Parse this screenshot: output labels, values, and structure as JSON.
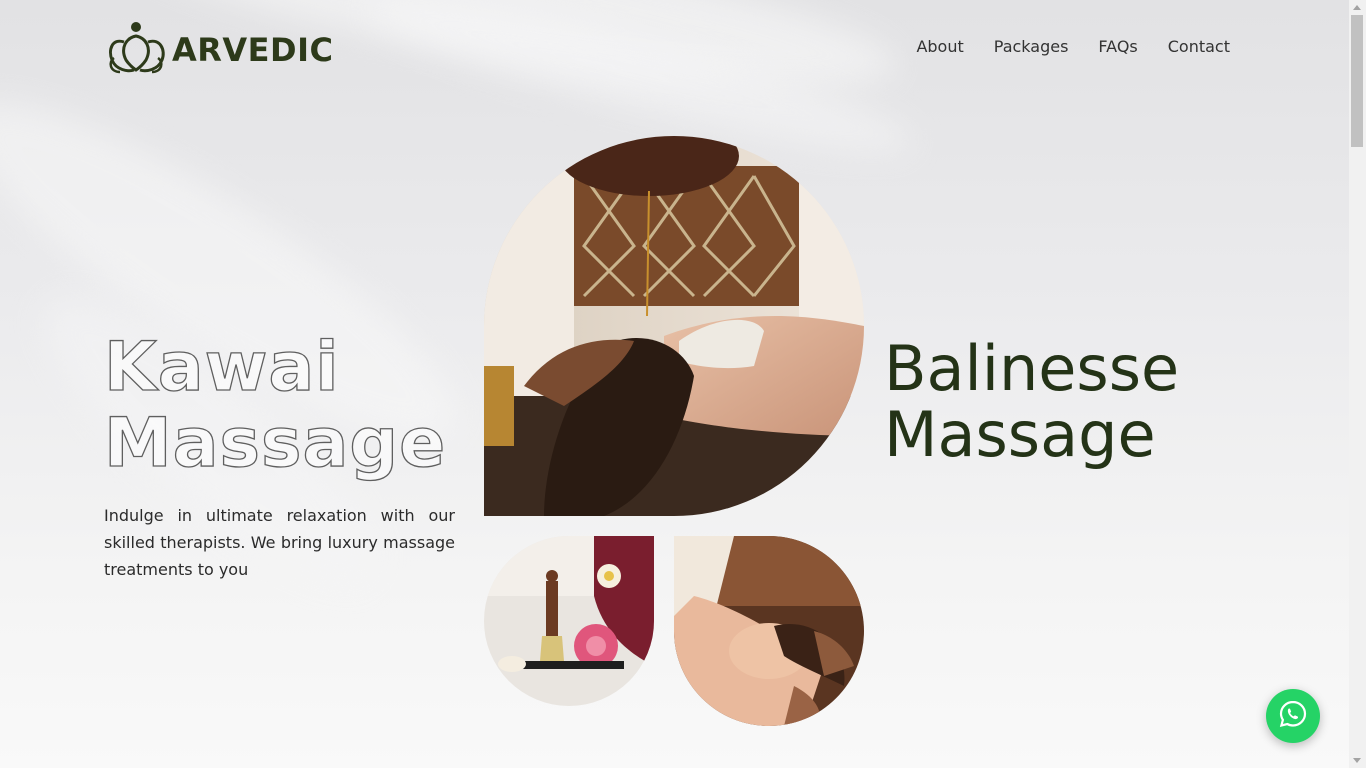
{
  "brand": {
    "name": "ARVEDIC",
    "logo_icon": "lotus-person-icon",
    "color": "#2d3a1a"
  },
  "nav": {
    "items": [
      "About",
      "Packages",
      "FAQs",
      "Contact"
    ]
  },
  "hero": {
    "outline_title_line1": "Kawai",
    "outline_title_line2": "Massage",
    "description": "Indulge in ultimate relaxation with our skilled therapists. We bring luxury massage treatments to you",
    "solid_title_line1": "Balinesse",
    "solid_title_line2": "Massage",
    "title_color": "#243317"
  },
  "images": {
    "main": "oil-pouring-head-massage-photo",
    "small_left": "spa-brush-and-flower-photo",
    "small_right": "face-massage-photo"
  },
  "whatsapp": {
    "icon": "whatsapp-icon",
    "color": "#25d366"
  }
}
